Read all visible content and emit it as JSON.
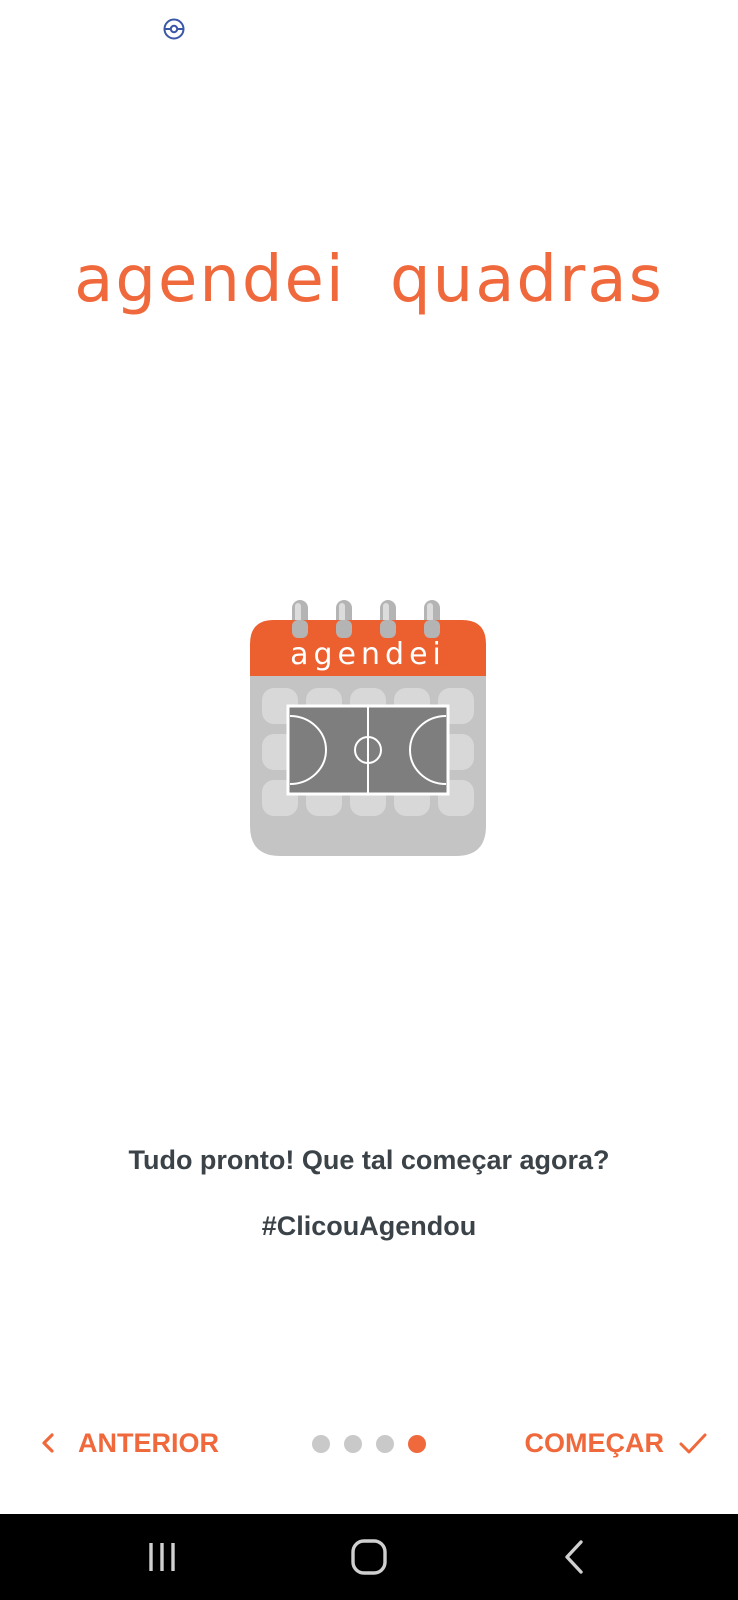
{
  "status_bar": {
    "icon": "circle-status-icon"
  },
  "brand": {
    "title": "agendei quadras",
    "color": "#f0693c"
  },
  "logo": {
    "icon": "calendar-court-logo",
    "label": "agendei"
  },
  "content": {
    "message": "Tudo pronto! Que tal começar agora?",
    "hashtag": "#ClicouAgendou"
  },
  "onboarding_nav": {
    "prev_label": "ANTERIOR",
    "next_label": "COMEÇAR",
    "page_count": 4,
    "current_page": 4,
    "accent_color": "#f0693c"
  },
  "system_nav": {
    "recents": "recents-icon",
    "home": "home-icon",
    "back": "back-icon"
  }
}
